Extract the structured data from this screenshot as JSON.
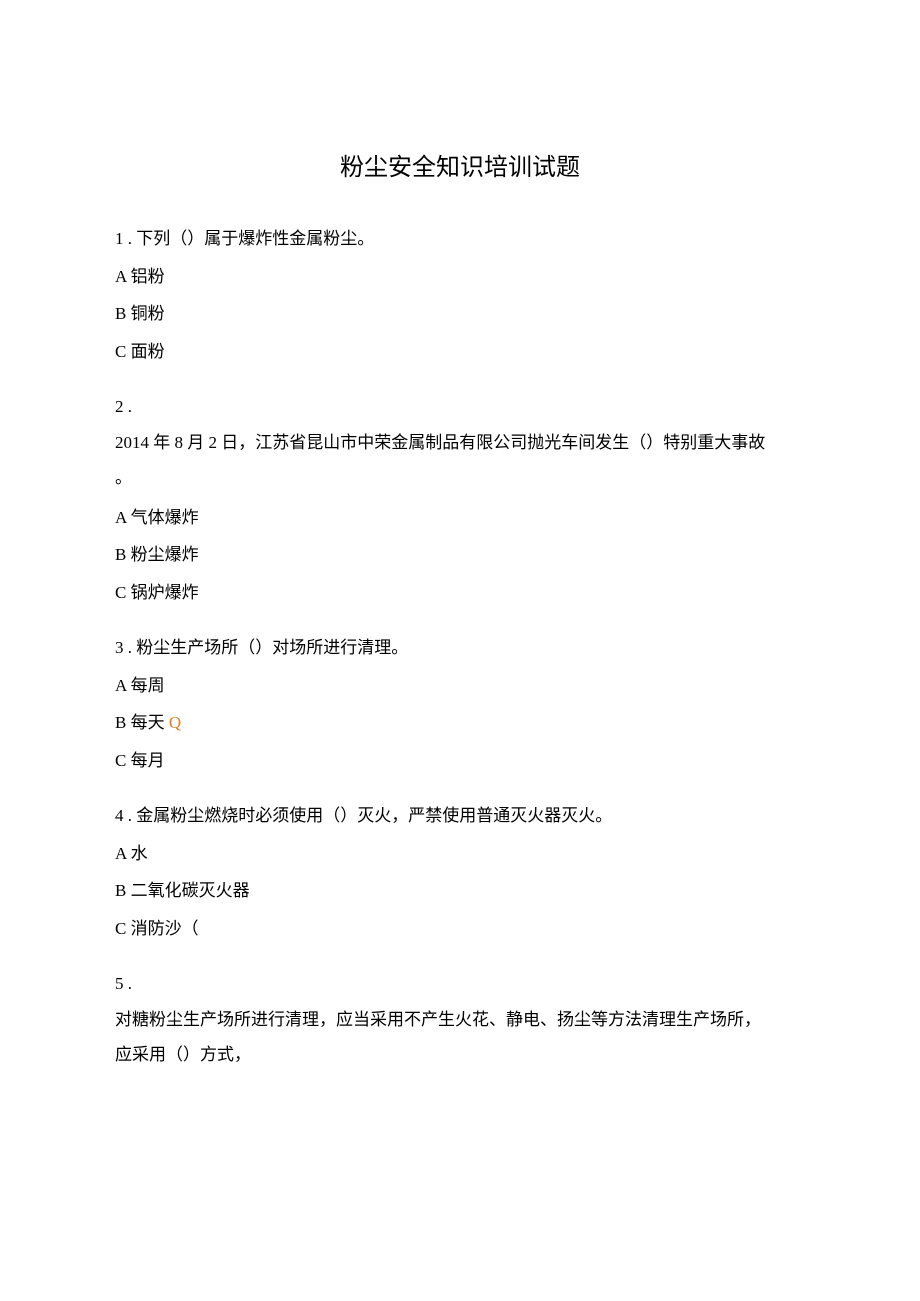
{
  "title": "粉尘安全知识培训试题",
  "q1": {
    "stem": "1 . 下列（）属于爆炸性金属粉尘。",
    "a": "A 铝粉",
    "b": "B 铜粉",
    "c": "C 面粉"
  },
  "q2": {
    "num": "2  .",
    "stem_line1": "2014 年 8 月 2 日，江苏省昆山市中荣金属制品有限公司抛光车间发生（）特别重大事故",
    "stem_line2": "。",
    "a": "A 气体爆炸",
    "b": "B 粉尘爆炸",
    "c": "C 锅炉爆炸"
  },
  "q3": {
    "stem": "3  . 粉尘生产场所（）对场所进行清理。",
    "a": "A 每周",
    "b_prefix": "B 每天 ",
    "b_accent": "Q",
    "c": "C 每月"
  },
  "q4": {
    "stem": "4  . 金属粉尘燃烧时必须使用（）灭火，严禁使用普通灭火器灭火。",
    "a": "A 水",
    "b": "B 二氧化碳灭火器",
    "c": "C 消防沙（"
  },
  "q5": {
    "num": "5  .",
    "stem_line1": "对糖粉尘生产场所进行清理，应当采用不产生火花、静电、扬尘等方法清理生产场所，",
    "stem_line2": "应采用（）方式，"
  }
}
